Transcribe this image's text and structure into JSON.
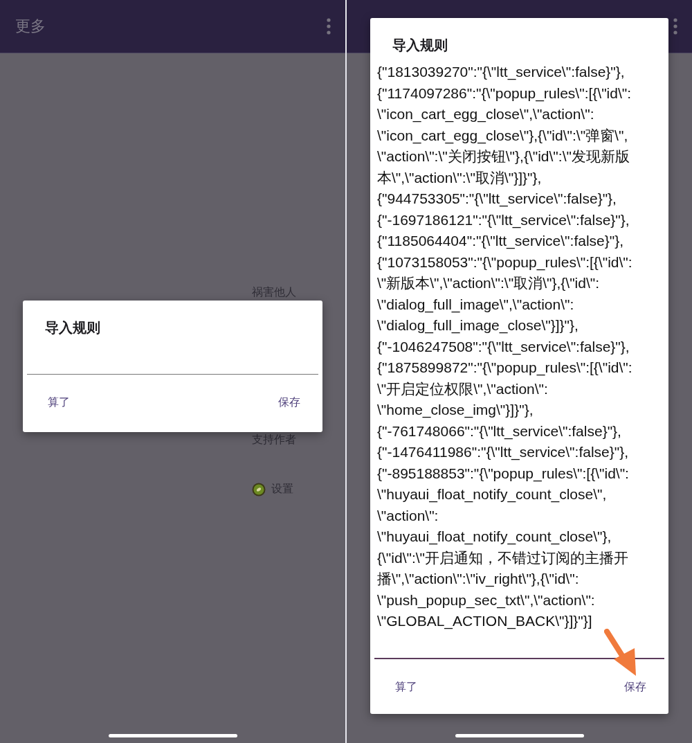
{
  "screens": [
    {
      "app_bar": {
        "title": "更多"
      },
      "menu": {
        "items": [
          {
            "label": "祸害他人",
            "kind": "text"
          },
          {
            "label": "支持作者",
            "kind": "text"
          },
          {
            "label": "设置",
            "kind": "icon"
          }
        ]
      },
      "dialog": {
        "title": "导入规则",
        "buttons": [
          {
            "label": "算了"
          },
          {
            "label": "保存"
          }
        ]
      }
    },
    {
      "dialog": {
        "title": "导入规则",
        "field": {
          "lines": [
            "{\"1813039270\":\"{\\\"ltt_service\\\":false}\"},",
            "{\"1174097286\":\"{\\\"popup_rules\\\":[{\\\"id\\\":",
            "\\\"icon_cart_egg_close\\\",\\\"action\\\":",
            "\\\"icon_cart_egg_close\\\"},{\\\"id\\\":\\\"弹窗\\\",",
            "\\\"action\\\":\\\"关闭按钮\\\"},{\\\"id\\\":\\\"发现新版",
            "本\\\",\\\"action\\\":\\\"取消\\\"}]}\"},",
            "{\"944753305\":\"{\\\"ltt_service\\\":false}\"},",
            "{\"-1697186121\":\"{\\\"ltt_service\\\":false}\"},",
            "{\"1185064404\":\"{\\\"ltt_service\\\":false}\"},",
            "{\"1073158053\":\"{\\\"popup_rules\\\":[{\\\"id\\\":",
            "\\\"新版本\\\",\\\"action\\\":\\\"取消\\\"},{\\\"id\\\":",
            "\\\"dialog_full_image\\\",\\\"action\\\":",
            "\\\"dialog_full_image_close\\\"}]}\"},",
            "{\"-1046247508\":\"{\\\"ltt_service\\\":false}\"},",
            "{\"1875899872\":\"{\\\"popup_rules\\\":[{\\\"id\\\":",
            "\\\"开启定位权限\\\",\\\"action\\\":",
            "\\\"home_close_img\\\"}]}\"},",
            "{\"-761748066\":\"{\\\"ltt_service\\\":false}\"},",
            "{\"-1476411986\":\"{\\\"ltt_service\\\":false}\"},",
            "{\"-895188853\":\"{\\\"popup_rules\\\":[{\\\"id\\\":",
            "\\\"huyaui_float_notify_count_close\\\",",
            "\\\"action\\\":",
            "\\\"huyaui_float_notify_count_close\\\"},",
            "{\\\"id\\\":\\\"开启通知，不错过订阅的主播开",
            "播\\\",\\\"action\\\":\\\"iv_right\\\"},{\\\"id\\\":",
            "\\\"push_popup_sec_txt\\\",\\\"action\\\":",
            "\\\"GLOBAL_ACTION_BACK\\\"}]}\"}]"
          ]
        },
        "buttons": [
          {
            "label": "算了"
          },
          {
            "label": "保存"
          }
        ]
      },
      "annotation": {
        "kind": "arrow"
      }
    }
  ]
}
